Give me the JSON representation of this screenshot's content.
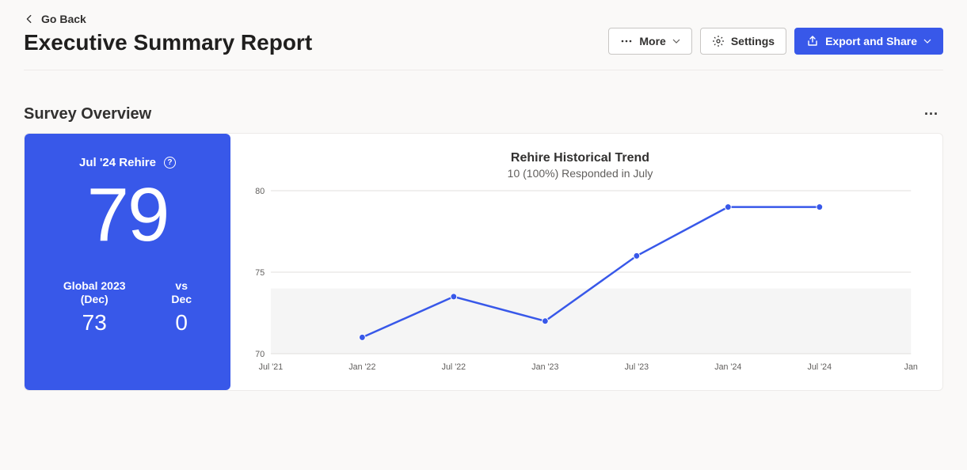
{
  "nav": {
    "goback": "Go Back"
  },
  "header": {
    "title": "Executive Summary Report",
    "more": "More",
    "settings": "Settings",
    "export": "Export and Share"
  },
  "section": {
    "title": "Survey Overview"
  },
  "score_card": {
    "label": "Jul '24 Rehire",
    "value": "79",
    "compare_left_label_l1": "Global 2023",
    "compare_left_label_l2": "(Dec)",
    "compare_left_value": "73",
    "compare_right_label_l1": "vs",
    "compare_right_label_l2": "Dec",
    "compare_right_value": "0"
  },
  "chart": {
    "title": "Rehire Historical Trend",
    "subtitle": "10 (100%) Responded in July"
  },
  "chart_data": {
    "type": "line",
    "title": "Rehire Historical Trend",
    "subtitle": "10 (100%) Responded in July",
    "x_categories": [
      "Jul '21",
      "Jan '22",
      "Jul '22",
      "Jan '23",
      "Jul '23",
      "Jan '24",
      "Jul '24",
      "Jan"
    ],
    "y_ticks": [
      70,
      75,
      80
    ],
    "ylim": [
      70,
      80
    ],
    "series": [
      {
        "name": "Rehire",
        "points": [
          {
            "x": "Jan '22",
            "y": 71
          },
          {
            "x": "Jul '22",
            "y": 73.5
          },
          {
            "x": "Jan '23",
            "y": 72
          },
          {
            "x": "Jul '23",
            "y": 76
          },
          {
            "x": "Jan '24",
            "y": 79
          },
          {
            "x": "Jul '24",
            "y": 79
          }
        ]
      }
    ]
  }
}
